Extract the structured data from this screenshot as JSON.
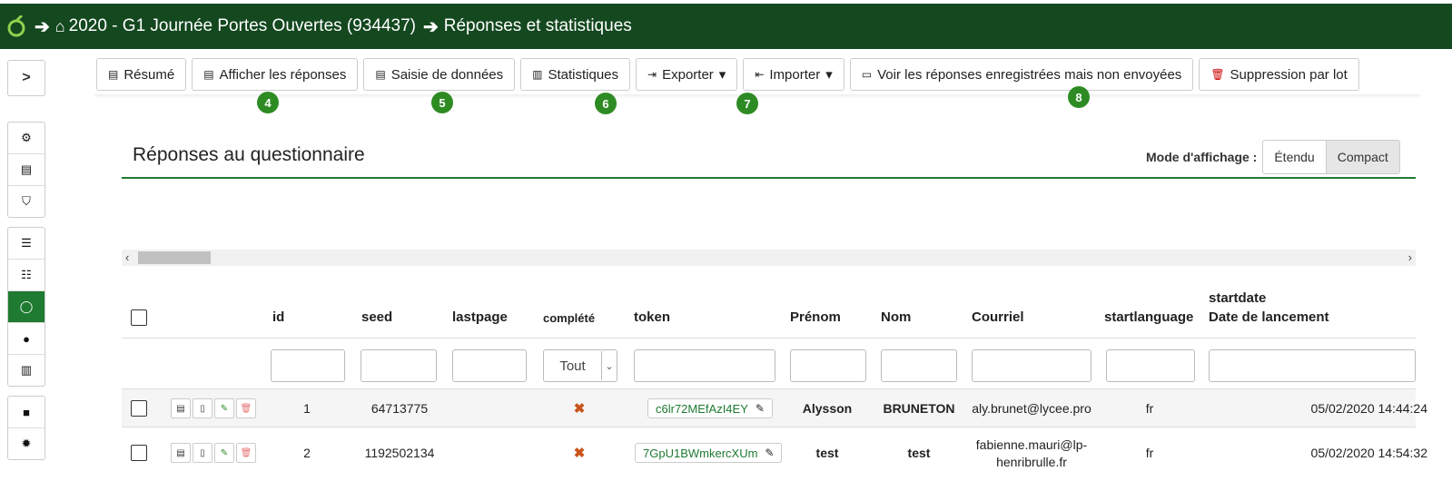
{
  "header": {
    "survey": "2020 - G1 Journée Portes Ouvertes (934437)",
    "page": "Réponses et statistiques",
    "bg_color": "#14481f"
  },
  "toolbar": {
    "summary": "Résumé",
    "display_responses": "Afficher les réponses",
    "data_entry": "Saisie de données",
    "statistics": "Statistiques",
    "export": "Exporter",
    "import": "Importer",
    "saved_not_sent": "Voir les réponses enregistrées mais non envoyées",
    "batch_delete": "Suppression par lot"
  },
  "badges": [
    "4",
    "5",
    "6",
    "7",
    "8"
  ],
  "panel": {
    "title": "Réponses au questionnaire",
    "display_mode_label": "Mode d'affichage :",
    "mode_extended": "Étendu",
    "mode_compact": "Compact",
    "accent": "#1f7a32"
  },
  "columns": {
    "id": "id",
    "seed": "seed",
    "lastpage": "lastpage",
    "completed": "complété",
    "token": "token",
    "firstname": "Prénom",
    "lastname": "Nom",
    "email": "Courriel",
    "startlanguage": "startlanguage",
    "startdate_code": "startdate",
    "startdate_label": "Date de lancement"
  },
  "filters": {
    "completed_value": "Tout"
  },
  "rows": [
    {
      "id": "1",
      "seed": "64713775",
      "completed": "✖",
      "token": "c6lr72MEfAzI4EY",
      "firstname": "Alysson",
      "lastname": "BRUNETON",
      "email": "aly.brunet@lycee.pro",
      "email2": "",
      "startlanguage": "fr",
      "startdate": "05/02/2020 14:44:24"
    },
    {
      "id": "2",
      "seed": "1192502134",
      "completed": "✖",
      "token": "7GpU1BWmkercXUm",
      "firstname": "test",
      "lastname": "test",
      "email": "fabienne.mauri@lp-",
      "email2": "henribrulle.fr",
      "startlanguage": "fr",
      "startdate": "05/02/2020 14:54:32"
    }
  ]
}
